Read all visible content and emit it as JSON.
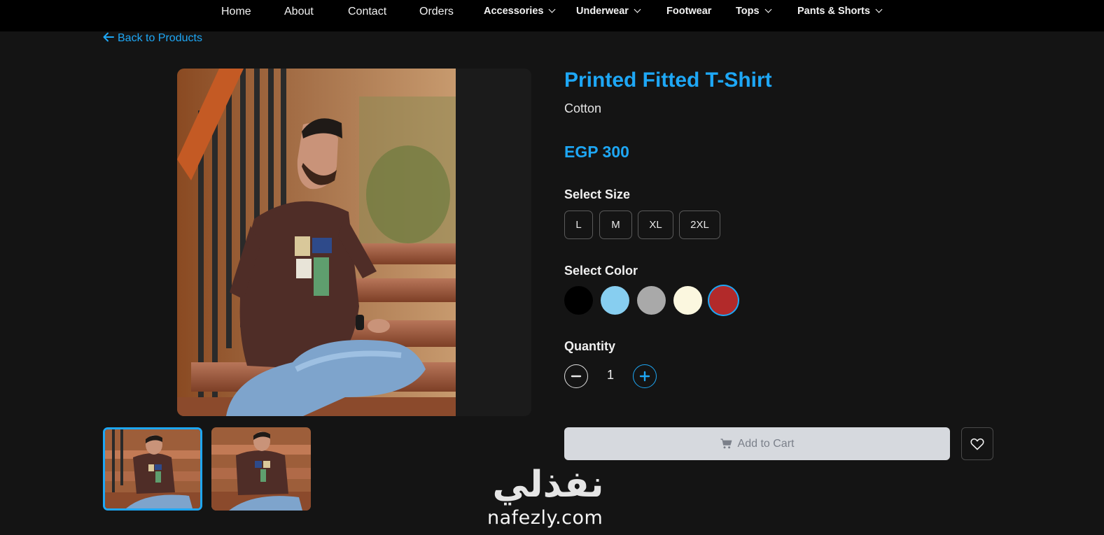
{
  "nav": {
    "items": [
      {
        "label": "Home"
      },
      {
        "label": "About"
      },
      {
        "label": "Contact"
      },
      {
        "label": "Orders"
      },
      {
        "label": "Accessories",
        "dropdown": true
      },
      {
        "label": "Underwear",
        "dropdown": true
      },
      {
        "label": "Footwear"
      },
      {
        "label": "Tops",
        "dropdown": true
      },
      {
        "label": "Pants & Shorts",
        "dropdown": true
      }
    ]
  },
  "back_link": "Back to Products",
  "product": {
    "title": "Printed Fitted T-Shirt",
    "material": "Cotton",
    "price": "EGP 300",
    "size_label": "Select Size",
    "sizes": [
      "L",
      "M",
      "XL",
      "2XL"
    ],
    "color_label": "Select Color",
    "colors": [
      "#000000",
      "#87cef0",
      "#a9a9a9",
      "#fbf7df",
      "#b22a2a"
    ],
    "selected_color": "#b22a2a",
    "quantity_label": "Quantity",
    "quantity": "1",
    "add_to_cart": "Add to Cart",
    "thumbnail_count": 2,
    "active_thumbnail": 1
  },
  "theme": {
    "accent": "#1ea7f5",
    "background": "#141414",
    "navbar": "#000000"
  },
  "watermark": {
    "arabic": "نفذلي",
    "latin": "nafezly.com"
  },
  "icons": {
    "back": "arrow-left-icon",
    "dropdown": "chevron-down-icon",
    "minus": "minus-icon",
    "plus": "plus-icon",
    "cart": "cart-icon",
    "wishlist": "heart-icon"
  }
}
